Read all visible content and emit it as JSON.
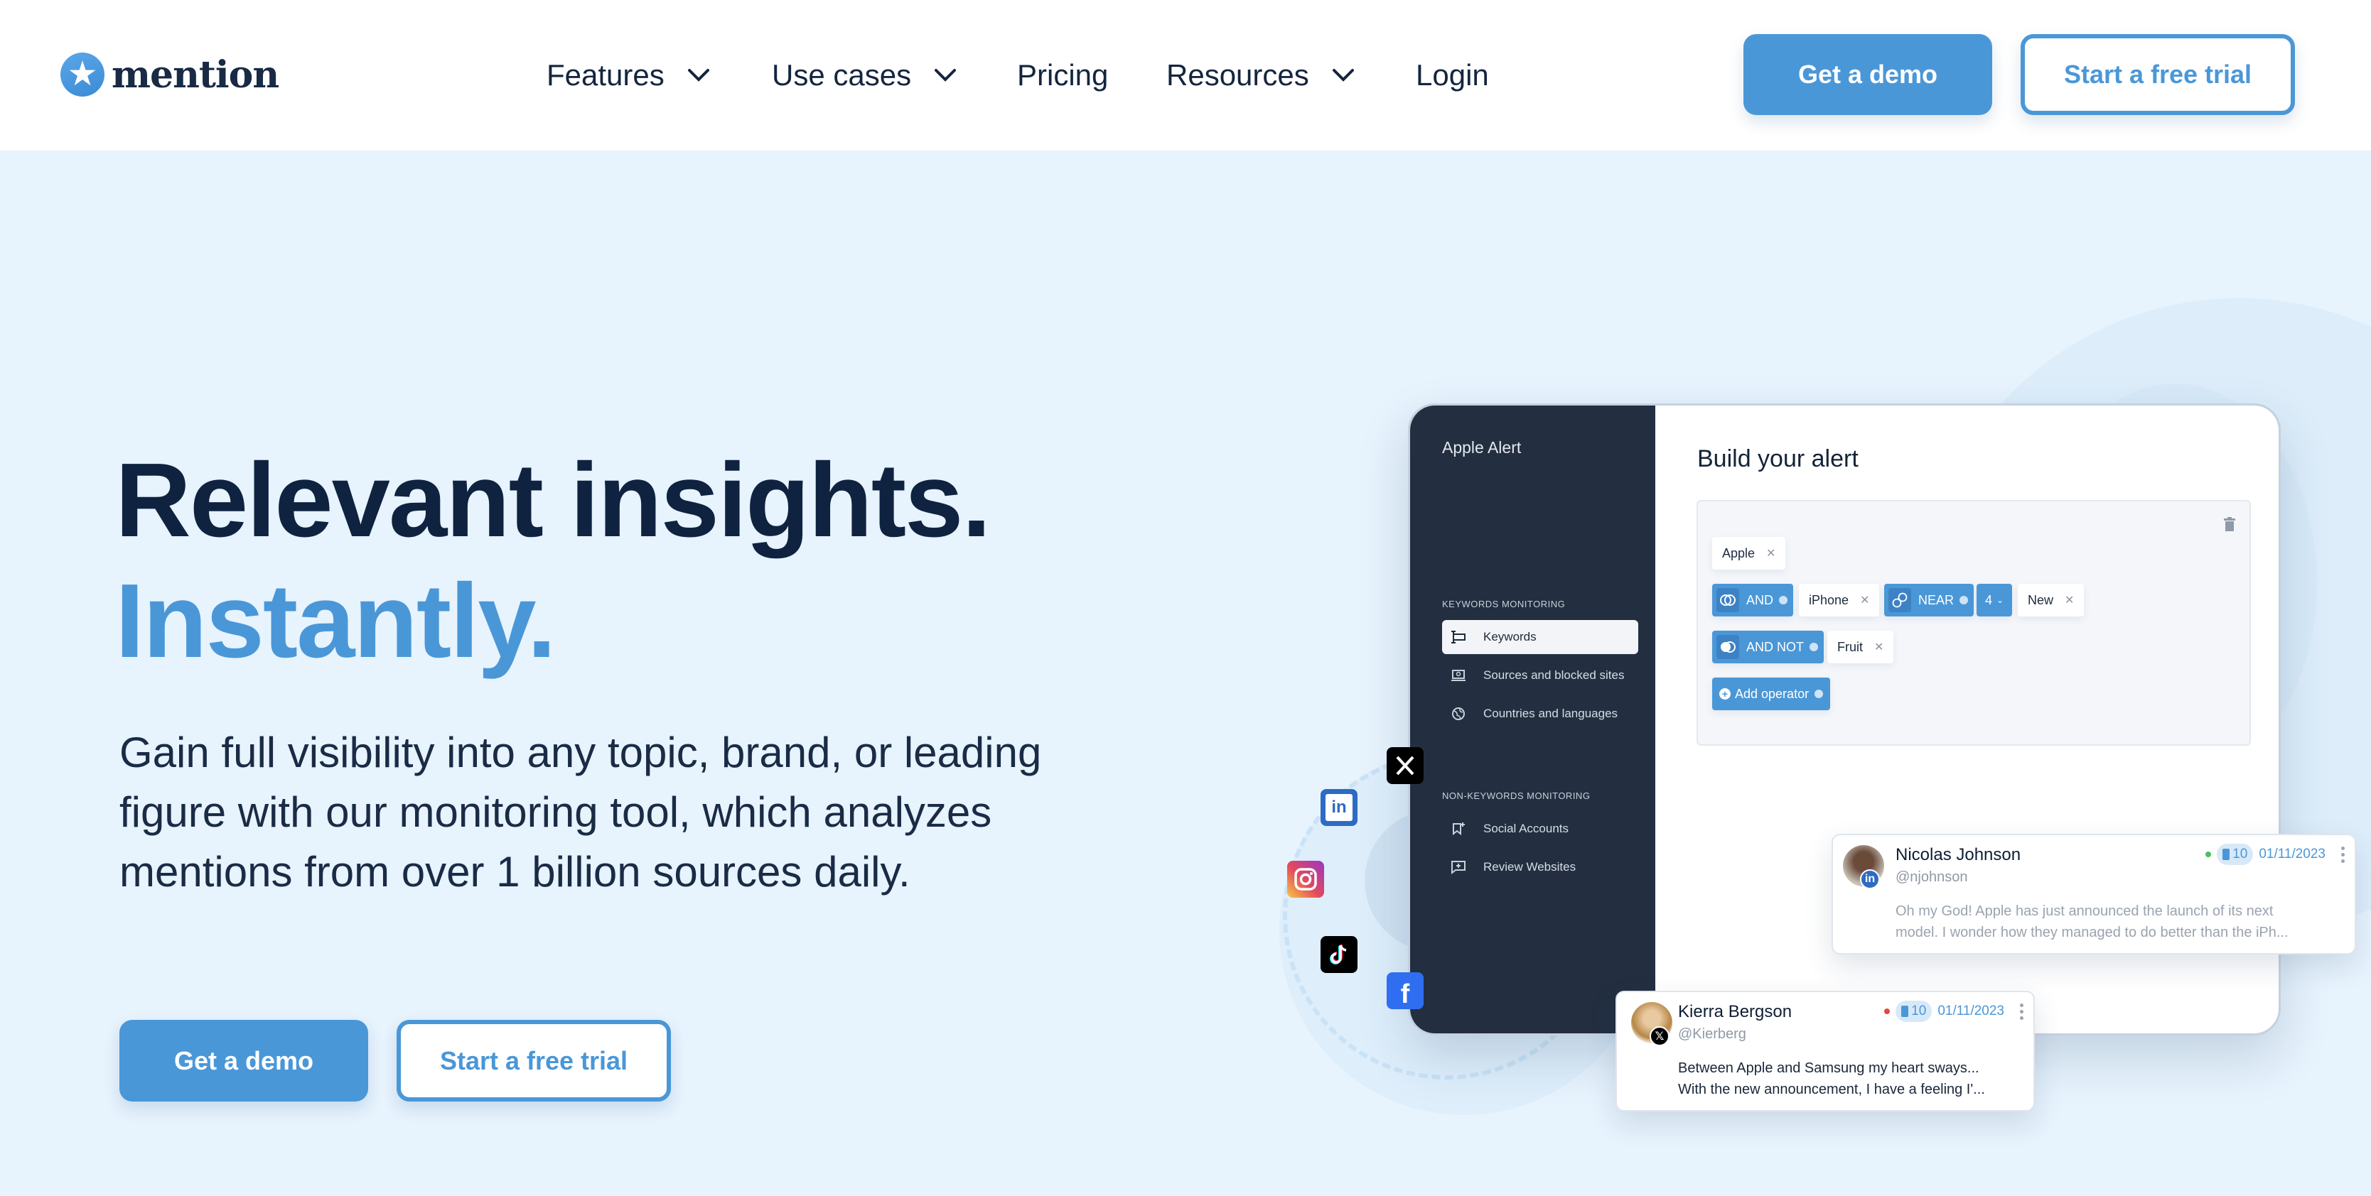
{
  "header": {
    "logo_text": "mention",
    "nav": [
      {
        "label": "Features",
        "has_dropdown": true
      },
      {
        "label": "Use cases",
        "has_dropdown": true
      },
      {
        "label": "Pricing",
        "has_dropdown": false
      },
      {
        "label": "Resources",
        "has_dropdown": true
      },
      {
        "label": "Login",
        "has_dropdown": false
      }
    ],
    "demo_button": "Get a demo",
    "trial_button": "Start a free trial"
  },
  "hero": {
    "headline_line1": "Relevant insights.",
    "headline_line2": "Instantly.",
    "subtext": "Gain full visibility into any topic, brand, or leading figure with our monitoring tool, which analyzes mentions from over 1 billion sources daily.",
    "demo_button": "Get a demo",
    "trial_button": "Start a free trial"
  },
  "app": {
    "alert_name": "Apple Alert",
    "sections": [
      {
        "title": "KEYWORDS MONITORING",
        "items": [
          {
            "label": "Keywords",
            "icon": "keyword-icon",
            "active": true
          },
          {
            "label": "Sources and blocked sites",
            "icon": "sources-icon",
            "active": false
          },
          {
            "label": "Countries and languages",
            "icon": "globe-icon",
            "active": false
          }
        ]
      },
      {
        "title": "NON-KEYWORDS MONITORING",
        "items": [
          {
            "label": "Social Accounts",
            "icon": "social-accounts-icon",
            "active": false
          },
          {
            "label": "Review Websites",
            "icon": "review-icon",
            "active": false
          }
        ]
      }
    ],
    "builder_title": "Build your alert",
    "keyword_apple": "Apple",
    "op_and": "AND",
    "keyword_iphone": "iPhone",
    "op_near": "NEAR",
    "near_distance": "4",
    "keyword_new": "New",
    "op_and_not": "AND NOT",
    "keyword_fruit": "Fruit",
    "add_operator": "Add operator"
  },
  "social_sources": [
    "X",
    "LinkedIn",
    "Instagram",
    "TikTok",
    "Facebook"
  ],
  "mentions": [
    {
      "name": "Nicolas Johnson",
      "handle": "@njohnson",
      "network": "LinkedIn",
      "sentiment_color": "#4cc05a",
      "reach": "10",
      "date": "01/11/2023",
      "line1": "Oh my God! Apple has just announced the launch of its next",
      "line2": "model. I wonder how they managed to do better than the iPh..."
    },
    {
      "name": "Kierra Bergson",
      "handle": "@Kierberg",
      "network": "X",
      "sentiment_color": "#e2483d",
      "reach": "10",
      "date": "01/11/2023",
      "line1": "Between Apple and Samsung my heart sways...",
      "line2": "With the new announcement, I have a feeling I'..."
    }
  ],
  "colors": {
    "accent": "#4a97d8",
    "navy": "#0f2340",
    "hero_bg": "#e7f3fd",
    "sidebar_bg": "#232f41"
  }
}
